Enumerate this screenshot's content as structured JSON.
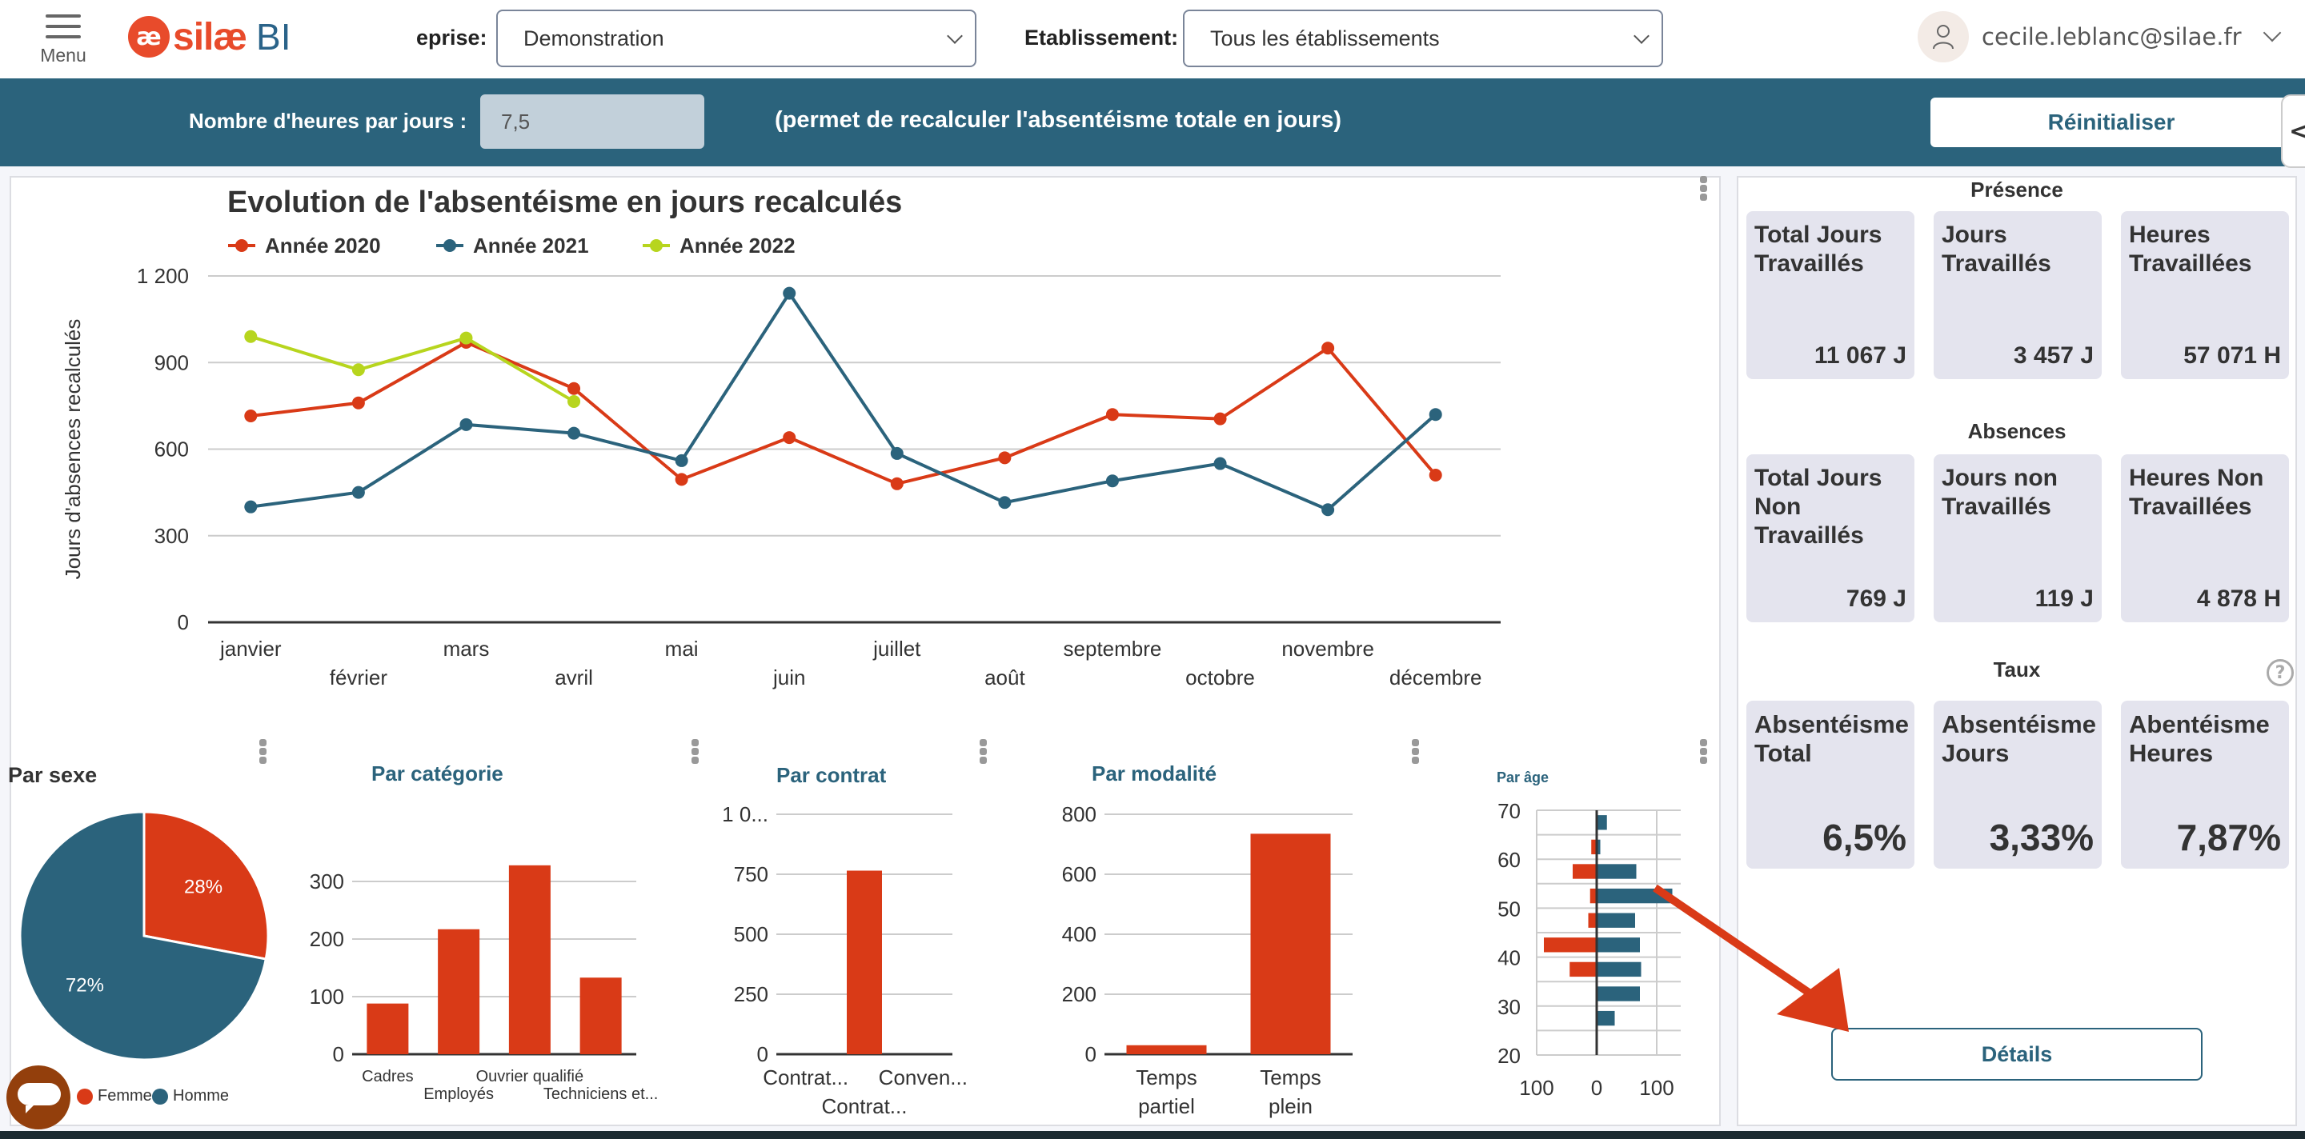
{
  "header": {
    "menu_label": "Menu",
    "logo_mark": "æ",
    "logo_word": "silæ",
    "logo_product": "BI",
    "company_label": "eprise:",
    "company_value": "Demonstration",
    "establishment_label": "Etablissement:",
    "establishment_value": "Tous les établissements",
    "user_email": "cecile.leblanc@silae.fr",
    "icons": {
      "menu": "hamburger-icon",
      "user": "user-icon",
      "dropdown": "chevron-down-icon"
    }
  },
  "toolbar": {
    "hours_label": "Nombre d'heures par jours :",
    "hours_value": "7,5",
    "hours_note": "(permet de recalculer l'absentéisme totale en jours)",
    "reset_label": "Réinitialiser",
    "collapse_label": "<"
  },
  "colors": {
    "year2020": "#d93a17",
    "year2021": "#2b637c",
    "year2022": "#b7d51e",
    "femme": "#d93a17",
    "homme": "#2b637c",
    "brand_blue": "#2b637c",
    "brand_orange": "#e84b2b"
  },
  "side_panel": {
    "presence": {
      "title": "Présence",
      "cards": [
        {
          "label": "Total Jours Travaillés",
          "value": "11 067 J"
        },
        {
          "label": "Jours Travaillés",
          "value": "3 457 J"
        },
        {
          "label": "Heures Travaillées",
          "value": "57 071 H"
        }
      ]
    },
    "absences": {
      "title": "Absences",
      "cards": [
        {
          "label": "Total Jours Non Travaillés",
          "value": "769 J"
        },
        {
          "label": "Jours non Travaillés",
          "value": "119 J"
        },
        {
          "label": "Heures Non Travaillées",
          "value": "4 878 H"
        }
      ]
    },
    "taux": {
      "title": "Taux",
      "help": "?",
      "cards": [
        {
          "label": "Absentéisme Total",
          "value": "6,5%"
        },
        {
          "label": "Absentéisme Jours",
          "value": "3,33%"
        },
        {
          "label": "Abentéisme Heures",
          "value": "7,87%"
        }
      ]
    },
    "details_label": "Détails"
  },
  "chart_data": [
    {
      "id": "evolution",
      "type": "line",
      "title": "Evolution de l'absentéisme en jours recalculés",
      "ylabel": "Jours d'absences recalculés",
      "xlabel": "",
      "ylim": [
        0,
        1200
      ],
      "yticks": [
        0,
        300,
        600,
        900,
        1200
      ],
      "ytick_labels": [
        "0",
        "300",
        "600",
        "900",
        "1 200"
      ],
      "grid": true,
      "legend": "top-left",
      "categories": [
        "janvier",
        "février",
        "mars",
        "avril",
        "mai",
        "juin",
        "juillet",
        "août",
        "septembre",
        "octobre",
        "novembre",
        "décembre"
      ],
      "series": [
        {
          "name": "Année 2020",
          "color": "#d93a17",
          "values": [
            715,
            760,
            970,
            810,
            495,
            640,
            480,
            570,
            720,
            705,
            950,
            510
          ]
        },
        {
          "name": "Année 2021",
          "color": "#2b637c",
          "values": [
            400,
            450,
            685,
            655,
            560,
            1140,
            585,
            415,
            490,
            550,
            390,
            720
          ]
        },
        {
          "name": "Année 2022",
          "color": "#b7d51e",
          "values": [
            990,
            875,
            985,
            765
          ]
        }
      ]
    },
    {
      "id": "sexe",
      "type": "pie",
      "title": "Par sexe",
      "legend": "bottom",
      "slices": [
        {
          "label": "Femme",
          "value": 28,
          "display": "28%",
          "color": "#d93a17"
        },
        {
          "label": "Homme",
          "value": 72,
          "display": "72%",
          "color": "#2b637c"
        }
      ]
    },
    {
      "id": "categorie",
      "type": "bar",
      "title": "Par catégorie",
      "categories": [
        "Cadres",
        "Employés",
        "Ouvrier qualifié",
        "Techniciens et..."
      ],
      "values": [
        88,
        217,
        328,
        133
      ],
      "ylim": [
        0,
        350
      ],
      "yticks": [
        0,
        100,
        200,
        300
      ],
      "ytick_labels": [
        "0",
        "100",
        "200",
        "300"
      ],
      "grid": true,
      "color": "#d93a17"
    },
    {
      "id": "contrat",
      "type": "bar",
      "title": "Par contrat",
      "categories": [
        "Contrat...",
        "Contrat...",
        "Conven..."
      ],
      "values": [
        0,
        765,
        0
      ],
      "ylim": [
        0,
        1000
      ],
      "yticks": [
        0,
        250,
        500,
        750,
        1000
      ],
      "ytick_labels": [
        "0",
        "250",
        "500",
        "750",
        "1 0..."
      ],
      "grid": true,
      "color": "#d93a17"
    },
    {
      "id": "modalite",
      "type": "bar",
      "title": "Par modalité",
      "categories": [
        "Temps partiel",
        "Temps plein"
      ],
      "values": [
        30,
        735
      ],
      "ylim": [
        0,
        800
      ],
      "yticks": [
        0,
        200,
        400,
        600,
        800
      ],
      "ytick_labels": [
        "0",
        "200",
        "400",
        "600",
        "800"
      ],
      "grid": true,
      "color": "#d93a17"
    },
    {
      "id": "age",
      "type": "bar",
      "title": "Par âge",
      "orientation": "horizontal-pyramid",
      "age_bins": [
        20,
        25,
        30,
        35,
        40,
        45,
        50,
        55,
        60,
        65
      ],
      "series": [
        {
          "name": "Femme",
          "color": "#d93a17",
          "values": [
            2,
            0,
            0,
            45,
            88,
            14,
            11,
            40,
            9,
            0
          ]
        },
        {
          "name": "Homme",
          "color": "#2b637c",
          "values": [
            0,
            30,
            72,
            74,
            72,
            64,
            126,
            66,
            6,
            17
          ]
        }
      ],
      "ylim": [
        20,
        70
      ],
      "yticks": [
        20,
        30,
        40,
        50,
        60,
        70
      ],
      "xlim": [
        -100,
        140
      ],
      "xticks": [
        -100,
        0,
        100
      ],
      "xtick_labels": [
        "100",
        "0",
        "100"
      ],
      "grid": true
    }
  ]
}
